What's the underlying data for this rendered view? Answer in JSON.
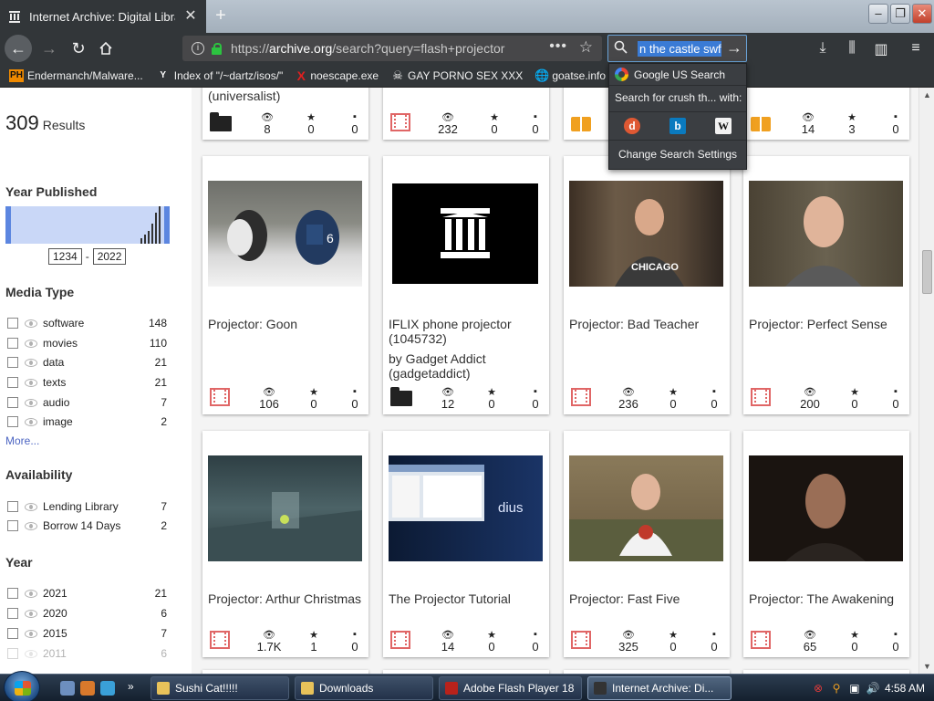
{
  "browser": {
    "tab_title": "Internet Archive: Digital Library",
    "url_prefix": "https://",
    "url_domain": "archive.org",
    "url_path": "/search?query=flash+projector",
    "search_value": "n the castle swf",
    "search_dropdown": {
      "google_label": "Google US Search",
      "with_label": "Search for crush th... with:",
      "engines": [
        "duckduckgo-icon",
        "bing-icon",
        "wikipedia-icon"
      ],
      "settings_label": "Change Search Settings"
    },
    "bookmarks": [
      {
        "icon": "PH",
        "label": "Endermanch/Malware..."
      },
      {
        "icon": "Y",
        "label": "Index of \"/~dartz/isos/\""
      },
      {
        "icon": "X",
        "label": "noescape.exe"
      },
      {
        "icon": "skull",
        "label": "GAY PORNO SEX XXX"
      },
      {
        "icon": "globe",
        "label": "goatse.info"
      }
    ]
  },
  "sidebar": {
    "results_count": "309",
    "results_label": "Results",
    "year_published_title": "Year Published",
    "year_min": "1234",
    "year_sep": "-",
    "year_max": "2022",
    "media_type_title": "Media Type",
    "media_types": [
      {
        "label": "software",
        "count": "148"
      },
      {
        "label": "movies",
        "count": "110"
      },
      {
        "label": "data",
        "count": "21"
      },
      {
        "label": "texts",
        "count": "21"
      },
      {
        "label": "audio",
        "count": "7"
      },
      {
        "label": "image",
        "count": "2"
      }
    ],
    "more_label": "More...",
    "availability_title": "Availability",
    "availability": [
      {
        "label": "Lending Library",
        "count": "7"
      },
      {
        "label": "Borrow 14 Days",
        "count": "2"
      }
    ],
    "year_title": "Year",
    "years": [
      {
        "label": "2021",
        "count": "21"
      },
      {
        "label": "2020",
        "count": "6"
      },
      {
        "label": "2015",
        "count": "7"
      },
      {
        "label": "2011",
        "count": "6"
      }
    ]
  },
  "top_row": [
    {
      "title": "(universalist)",
      "type": "folder",
      "views": "8",
      "favs": "0",
      "reviews": "0"
    },
    {
      "title": "",
      "type": "film",
      "views": "232",
      "favs": "0",
      "reviews": "0"
    },
    {
      "title": "",
      "type": "book",
      "views": "",
      "favs": "",
      "reviews": ""
    },
    {
      "title": "",
      "type": "book",
      "views": "14",
      "favs": "3",
      "reviews": "0"
    }
  ],
  "row1": [
    {
      "title": "Projector: Goon",
      "byline": "",
      "type": "film",
      "views": "106",
      "favs": "0",
      "reviews": "0"
    },
    {
      "title": "IFLIX phone projector (1045732)",
      "byline": "by Gadget Addict (gadgetaddict)",
      "type": "folder",
      "views": "12",
      "favs": "0",
      "reviews": "0"
    },
    {
      "title": "Projector: Bad Teacher",
      "byline": "",
      "type": "film",
      "views": "236",
      "favs": "0",
      "reviews": "0"
    },
    {
      "title": "Projector: Perfect Sense",
      "byline": "",
      "type": "film",
      "views": "200",
      "favs": "0",
      "reviews": "0"
    }
  ],
  "row2": [
    {
      "title": "Projector: Arthur Christmas",
      "byline": "",
      "type": "film",
      "views": "1.7K",
      "favs": "1",
      "reviews": "0"
    },
    {
      "title": "The Projector Tutorial",
      "byline": "",
      "type": "film",
      "views": "14",
      "favs": "0",
      "reviews": "0"
    },
    {
      "title": "Projector: Fast Five",
      "byline": "",
      "type": "film",
      "views": "325",
      "favs": "0",
      "reviews": "0"
    },
    {
      "title": "Projector: The Awakening",
      "byline": "",
      "type": "film",
      "views": "65",
      "favs": "0",
      "reviews": "0"
    }
  ],
  "thumb_text": {
    "chicago_shirt": "CHICAGO",
    "dius_text": "dius"
  },
  "taskbar": {
    "tasks": [
      "Sushi Cat!!!!!",
      "Downloads",
      "Adobe Flash Player 18",
      "Internet Archive: Di..."
    ],
    "clock": "4:58 AM"
  }
}
